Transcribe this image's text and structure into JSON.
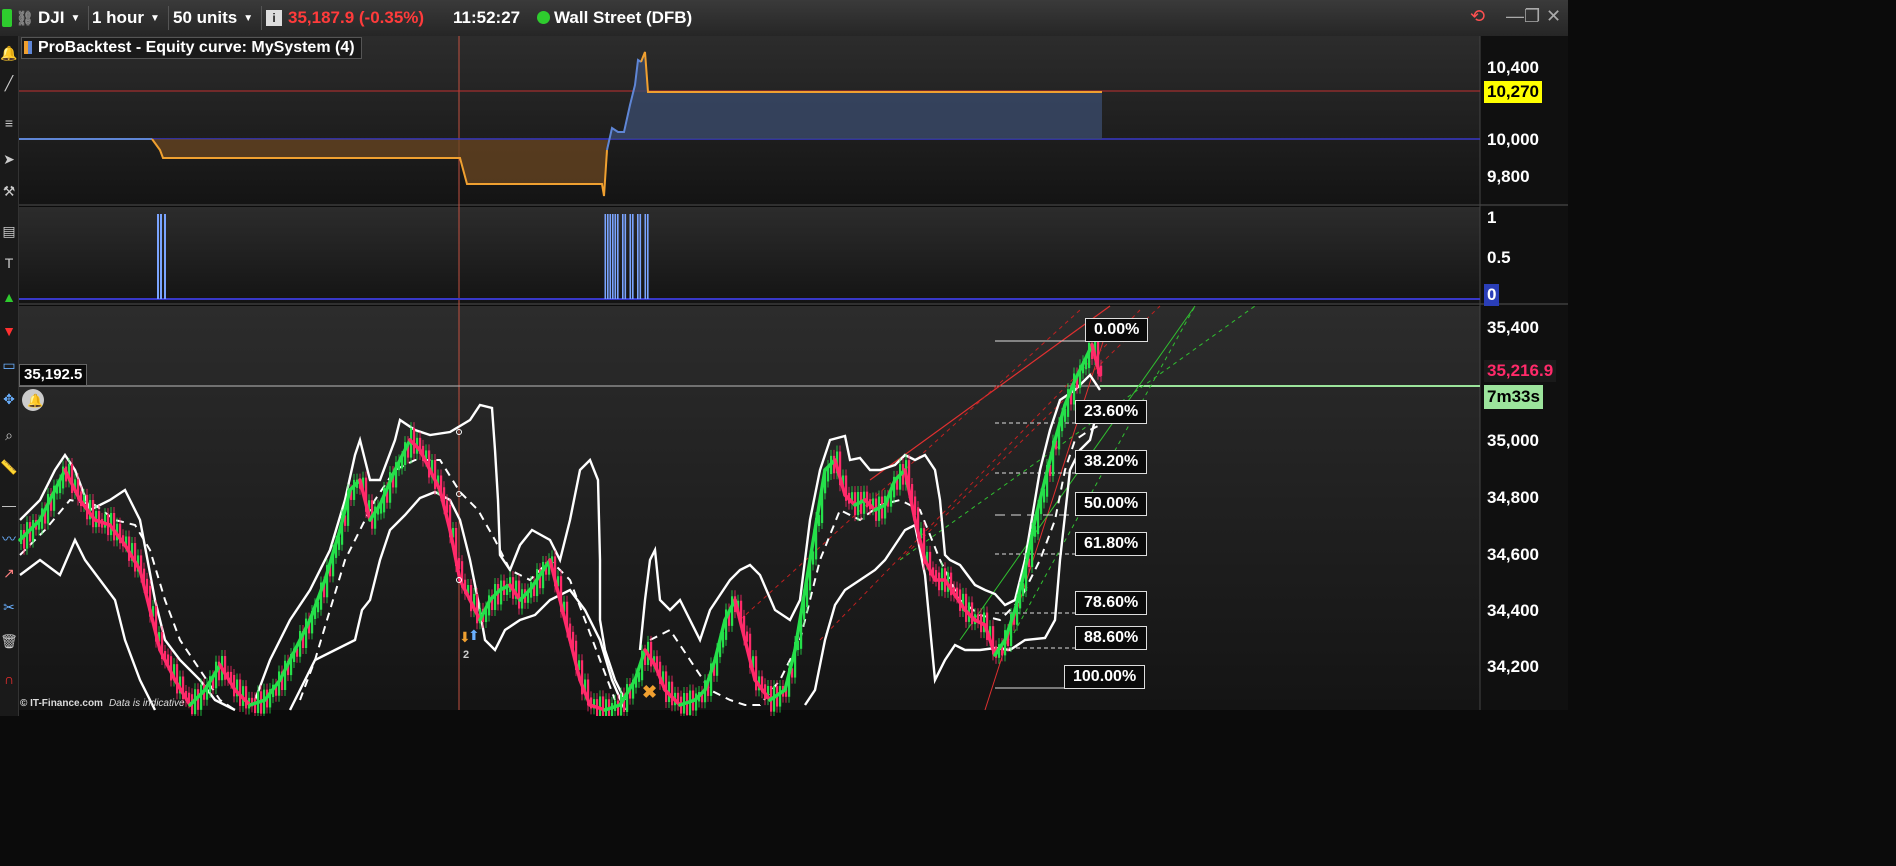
{
  "toolbar": {
    "symbol": "DJI",
    "timeframe": "1 hour",
    "units": "50 units",
    "info_icon": "info-icon",
    "price_change": "35,187.9 (-0.35%)",
    "time": "11:52:27",
    "market_status_color": "#2ecc2e",
    "market": "Wall Street (DFB)",
    "price_change_color": "#ff3b3b"
  },
  "equity_panel": {
    "title": "ProBacktest - Equity curve: MySystem (4)",
    "y_ticks": [
      "10,400",
      "10,000",
      "9,800"
    ],
    "current_value": "10,270"
  },
  "position_panel": {
    "y_ticks": [
      "1",
      "0.5"
    ],
    "current_value": "0"
  },
  "price_panel": {
    "y_ticks": [
      "35,400",
      "35,000",
      "34,800",
      "34,600",
      "34,400",
      "34,200"
    ],
    "crosshair_price": "35,192.5",
    "current_price": "35,216.9",
    "countdown": "7m33s",
    "trade_marker_label": "2",
    "fib_levels": [
      "0.00%",
      "23.60%",
      "38.20%",
      "50.00%",
      "61.80%",
      "78.60%",
      "88.60%",
      "100.00%"
    ]
  },
  "footer": {
    "source": "© IT-Finance.com",
    "disclaimer": "Data is indicative"
  },
  "colors": {
    "up_candle": "#25e04a",
    "down_candle": "#ff2a6a",
    "equity_negative": "#f0a030",
    "equity_positive": "#5f86d6",
    "position_bars": "#7aa4ff",
    "price_flag": "#ff2a6a",
    "countdown_bg": "#9ce49c",
    "equity_flag_bg": "#ffff00"
  },
  "sidebar_icons": [
    "alert-icon",
    "draw-line-icon",
    "indicator-icon",
    "cursor-icon",
    "hammer-icon",
    "document-icon",
    "text-icon",
    "up-arrow-icon",
    "down-arrow-icon",
    "rectangle-icon",
    "move-icon",
    "zoom-icon",
    "ruler-icon",
    "minus-icon",
    "line-chart-icon",
    "trend-icon",
    "scissors-icon",
    "trash-icon",
    "magnet-icon"
  ]
}
